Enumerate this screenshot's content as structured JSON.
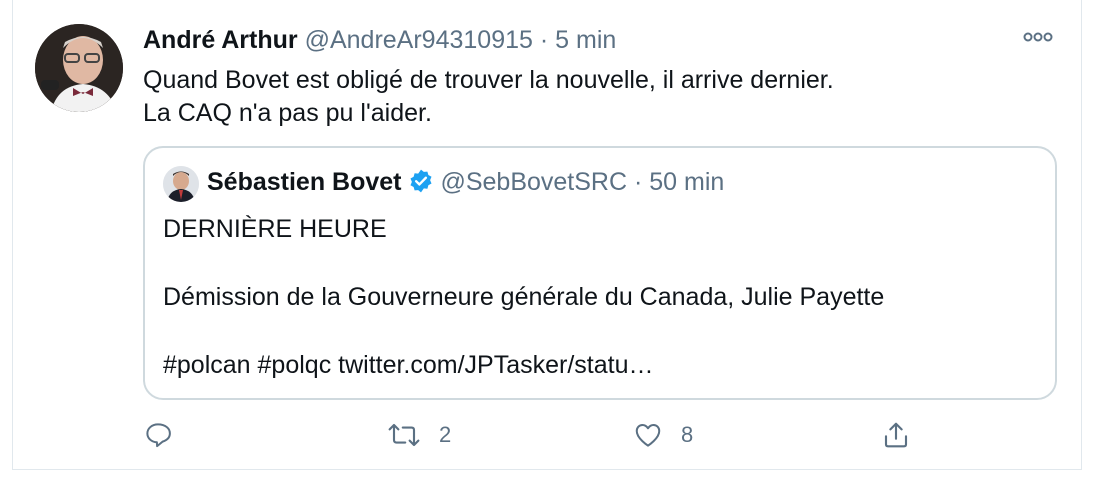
{
  "tweet": {
    "author_name": "André Arthur",
    "author_handle": "@AndreAr94310915",
    "separator": "·",
    "time": "5 min",
    "text_line1": "Quand Bovet est obligé de trouver la nouvelle, il arrive dernier.",
    "text_line2": "La CAQ n'a pas pu l'aider.",
    "more_icon": "more-horizontal-icon"
  },
  "quoted": {
    "author_name": "Sébastien Bovet",
    "verified": true,
    "author_handle": "@SebBovetSRC",
    "separator": "·",
    "time": "50 min",
    "line1": "DERNIÈRE HEURE",
    "line2": "Démission de la Gouverneure générale du Canada, Julie Payette",
    "line3": "#polcan #polqc twitter.com/JPTasker/statu…"
  },
  "actions": {
    "reply_count": "",
    "retweet_count": "2",
    "like_count": "8",
    "share_count": ""
  },
  "colors": {
    "text_primary": "#0f1419",
    "text_secondary": "#5b7083",
    "border": "#cfd9de",
    "verified_blue": "#1da1f2"
  }
}
